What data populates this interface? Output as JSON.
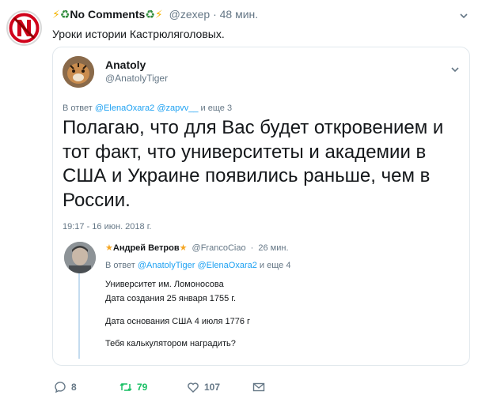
{
  "tweet": {
    "display_name": "No Comments",
    "handle": "@zexep",
    "separator": "·",
    "time": "48 мин.",
    "text": "Уроки истории Кастрюляголовых."
  },
  "quote": {
    "display_name": "Anatoly",
    "handle": "@AnatolyTiger",
    "replying_prefix": "В ответ",
    "replying_mention_1": "@ElenaOxara2",
    "replying_mention_2": "@zapvv__",
    "replying_suffix": "и еще 3",
    "body": "Полагаю, что для Вас будет откровением и тот факт, что университеты и академии в США и Украине появились раньше, чем в России.",
    "timestamp": "19:17 - 16 июн. 2018 г."
  },
  "reply": {
    "display_name": "Андрей Ветров",
    "handle": "@FrancoCiao",
    "separator": "·",
    "time": "26 мин.",
    "replying_prefix": "В ответ",
    "replying_mention_1": "@AnatolyTiger",
    "replying_mention_2": "@ElenaOxara2",
    "replying_suffix": "и еще 4",
    "line1": "Университет им. Ломоносова",
    "line2": "Дата создания 25 января 1755 г.",
    "line3": "Дата основания США 4 июля 1776 г",
    "line4": "Тебя калькулятором наградить?"
  },
  "actions": {
    "replies": "8",
    "retweets": "79",
    "likes": "107"
  },
  "colors": {
    "link": "#1da1f2",
    "retweet": "#17bf63",
    "muted": "#657786"
  },
  "icons": [
    "reply-icon",
    "retweet-icon",
    "like-icon",
    "message-icon",
    "chevron-down-icon",
    "lightning-icon",
    "recycle-icon",
    "star-icon"
  ]
}
